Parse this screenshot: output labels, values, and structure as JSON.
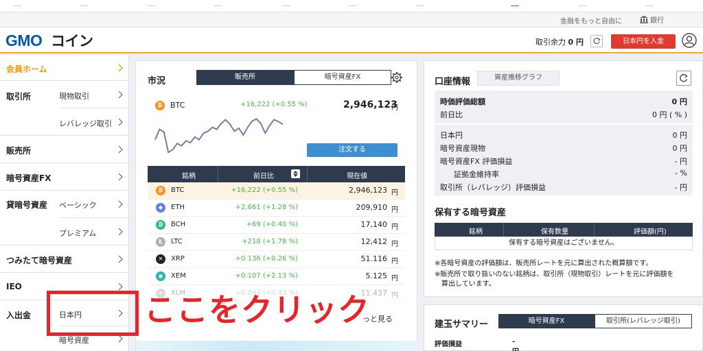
{
  "utilbar": {
    "tagline": "金融をもっと自由に",
    "bank_label": "銀行"
  },
  "header": {
    "logo_text": "GMOコイン",
    "available_label": "取引余力",
    "available_value": "0 円",
    "deposit_button": "日本円を入金"
  },
  "sidebar": {
    "home": "会員ホーム",
    "exchange": "取引所",
    "exchange_spot": "現物取引",
    "exchange_leverage": "レバレッジ取引",
    "sales": "販売所",
    "fx": "暗号資産FX",
    "lending": "貸暗号資産",
    "lending_basic": "ベーシック",
    "lending_premium": "プレミアム",
    "tsumitate": "つみたて暗号資産",
    "ieo": "IEO",
    "deposit": "入出金",
    "deposit_jpy": "日本円",
    "deposit_crypto": "暗号資産"
  },
  "market": {
    "title": "市況",
    "tabs": [
      "販売所",
      "暗号資産FX"
    ],
    "featured": {
      "symbol": "BTC",
      "change": "+16,222 (+0.55 %)",
      "price": "2,946,123",
      "unit": "円"
    },
    "order_button": "注文する",
    "columns": [
      "銘柄",
      "前日比",
      "現在値"
    ],
    "rows": [
      {
        "symbol": "BTC",
        "change": "+16,222 (+0.55 %)",
        "price": "2,946,123",
        "unit": "円",
        "color": "#f7931a",
        "glyph": "₿"
      },
      {
        "symbol": "ETH",
        "change": "+2,661 (+1.28 %)",
        "price": "209,910",
        "unit": "円",
        "color": "#627eea",
        "glyph": "◆"
      },
      {
        "symbol": "BCH",
        "change": "+69 (+0.40 %)",
        "price": "17,140",
        "unit": "円",
        "color": "#2fbe78",
        "glyph": "₿"
      },
      {
        "symbol": "LTC",
        "change": "+218 (+1.78 %)",
        "price": "12,412",
        "unit": "円",
        "color": "#b0b0b0",
        "glyph": "Ł"
      },
      {
        "symbol": "XRP",
        "change": "+0.136 (+0.26 %)",
        "price": "51.116",
        "unit": "円",
        "color": "#222222",
        "glyph": "✕"
      },
      {
        "symbol": "XEM",
        "change": "+0.107 (+2.13 %)",
        "price": "5.125",
        "unit": "円",
        "color": "#2ab5b0",
        "glyph": "◉"
      },
      {
        "symbol": "XLM",
        "change": "+0.049 (+0.43 %)",
        "price": "11.437",
        "unit": "円",
        "color": "#999999",
        "glyph": "✦"
      }
    ],
    "more_link": "っと見る",
    "sparkline": [
      0.62,
      0.35,
      0.42,
      0.95,
      0.88,
      0.72,
      0.78,
      0.65,
      0.7,
      0.55,
      0.62,
      0.45,
      0.4,
      0.3,
      0.35,
      0.2,
      0.1,
      0.22,
      0.4,
      0.32,
      0.5,
      0.3,
      0.14,
      0.08,
      0.2,
      0.45,
      0.25,
      0.1,
      0.15,
      0.22
    ]
  },
  "account": {
    "title": "口座情報",
    "graph_button": "資産推移グラフ",
    "summary": [
      {
        "label": "時価評価総額",
        "value": "0 円",
        "bold": true
      },
      {
        "label": "前日比",
        "value": "0 円 ( % )"
      }
    ],
    "details": [
      {
        "label": "日本円",
        "value": "0 円"
      },
      {
        "label": "暗号資産現物",
        "value": "0 円"
      },
      {
        "label": "暗号資産FX 評価損益",
        "value": "- 円"
      },
      {
        "label": "証拠金維持率",
        "value": "- %",
        "indent": true
      },
      {
        "label": "取引所（レバレッジ）評価損益",
        "value": "- 円"
      }
    ],
    "holdings_title": "保有する暗号資産",
    "holdings_columns": [
      "銘柄",
      "保有数量",
      "評価額(円)"
    ],
    "holdings_empty": "保有する暗号資産はございません。",
    "notes": [
      "※各暗号資産の評価額は、販売所レートを元に算出された概算額です。",
      "※販売所で取り扱いのない銘柄は、取引所（現物取引）レートを元に評価額を",
      "算出しています。"
    ]
  },
  "positions": {
    "title": "建玉サマリー",
    "tabs": [
      "暗号資産FX",
      "取引所(レバレッジ取引)"
    ],
    "pl_label": "評価損益",
    "pl_value": "- 円"
  },
  "annotation": {
    "text": "ここをクリック",
    "color": "#e8242b"
  }
}
